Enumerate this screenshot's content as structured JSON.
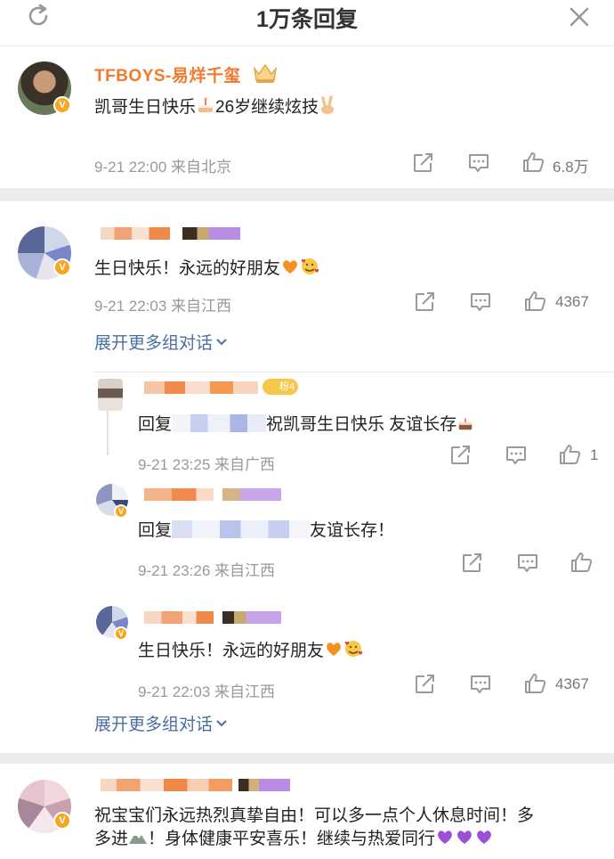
{
  "header": {
    "title": "1万条回复"
  },
  "comments": [
    {
      "name": "TFBOYS-易烊千玺",
      "text_before": "凯哥生日快乐",
      "text_after": "26岁继续炫技",
      "time": "9-21 22:00",
      "location": "来自北京",
      "likes": "6.8万"
    },
    {
      "text": "生日快乐！永远的好朋友",
      "time": "9-21 22:03",
      "location": "来自江西",
      "likes": "4367",
      "expand": "展开更多组对话"
    },
    {
      "text": "祝宝宝们永远热烈真挚自由！可以多一点个人休息时间！多",
      "text2": "多进",
      "text3": "！身体健康平安喜乐！继续与热爱同行"
    }
  ],
  "replies": [
    {
      "fan_badge": "粉4",
      "text_prefix": "回复",
      "text_suffix": "祝凯哥生日快乐 友谊长存",
      "time": "9-21 23:25",
      "location": "来自广西",
      "likes": "1"
    },
    {
      "text_prefix": "回复",
      "text_suffix": "友谊长存！",
      "time": "9-21 23:26",
      "location": "来自江西"
    },
    {
      "text": "生日快乐！永远的好朋友",
      "time": "9-21 22:03",
      "location": "来自江西",
      "likes": "4367",
      "expand": "展开更多组对话"
    }
  ],
  "colors": {
    "accent_name": "#f0792c",
    "link": "#4a6f9e",
    "meta": "#999999",
    "verified": "#f5a623"
  },
  "icons": [
    "refresh-icon",
    "close-icon",
    "crown-icon",
    "share-icon",
    "comment-icon",
    "like-icon",
    "cake-emoji",
    "peace-hand-emoji",
    "orange-heart-emoji",
    "smiling-face-hearts-emoji",
    "mountain-emoji",
    "purple-heart-emoji"
  ]
}
